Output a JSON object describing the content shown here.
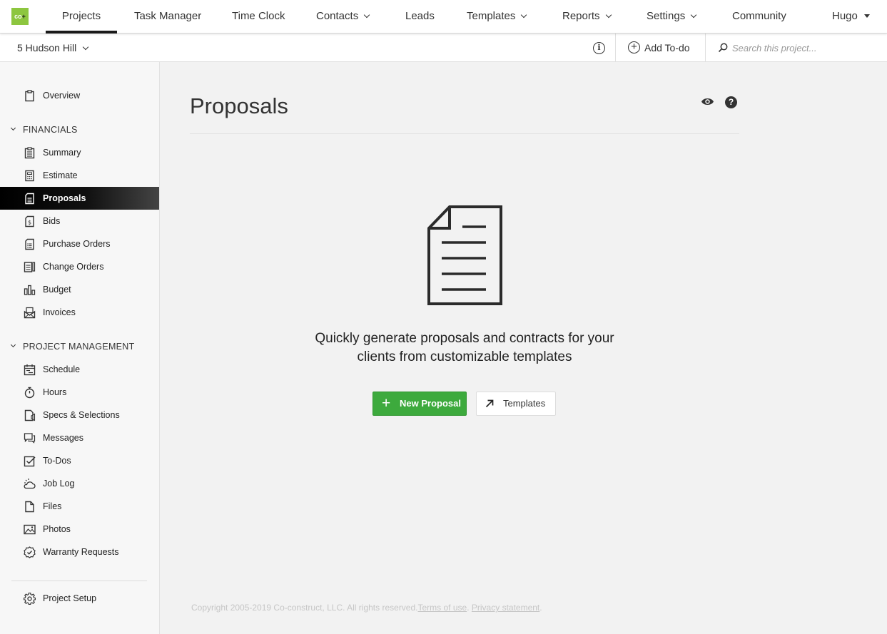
{
  "logo": {
    "text": "co",
    "plus": "+",
    "color": "#8dc63f"
  },
  "topnav": {
    "items": [
      {
        "label": "Projects",
        "active": true
      },
      {
        "label": "Task Manager"
      },
      {
        "label": "Time Clock"
      },
      {
        "label": "Contacts",
        "dropdown": true
      },
      {
        "label": "Leads"
      },
      {
        "label": "Templates",
        "dropdown": true
      },
      {
        "label": "Reports",
        "dropdown": true
      },
      {
        "label": "Settings",
        "dropdown": true
      },
      {
        "label": "Community"
      }
    ],
    "user": "Hugo"
  },
  "subbar": {
    "project": "5 Hudson Hill",
    "info_icon": "i",
    "add_todo": "Add To-do",
    "search_placeholder": "Search this project..."
  },
  "sidebar": {
    "overview": "Overview",
    "financials_heading": "FINANCIALS",
    "financials": [
      "Summary",
      "Estimate",
      "Proposals",
      "Bids",
      "Purchase Orders",
      "Change Orders",
      "Budget",
      "Invoices"
    ],
    "pm_heading": "PROJECT MANAGEMENT",
    "project_management": [
      "Schedule",
      "Hours",
      "Specs & Selections",
      "Messages",
      "To-Dos",
      "Job Log",
      "Files",
      "Photos",
      "Warranty Requests"
    ],
    "project_setup": "Project Setup",
    "active_item": "Proposals"
  },
  "main": {
    "title": "Proposals",
    "help_icon": "?",
    "empty_message_line1": "Quickly generate proposals and contracts for your",
    "empty_message_line2": "clients from customizable templates",
    "new_button": "New Proposal",
    "new_button_icon": "+",
    "templates_button": "Templates",
    "accent_green": "#3daa3d"
  },
  "footer": {
    "copyright": "Copyright 2005-2019 Co-construct, LLC. All rights reserved.",
    "terms": "Terms of use",
    "dot": ".",
    "privacy": "Privacy statement",
    "end": "."
  }
}
